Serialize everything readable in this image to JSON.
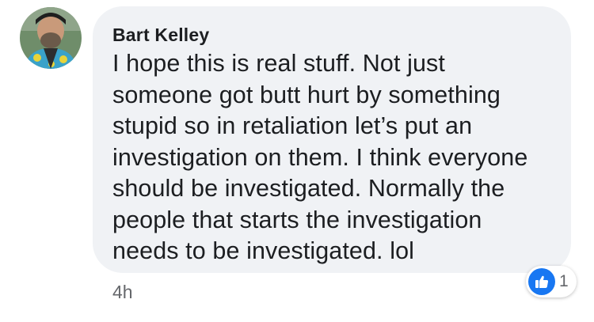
{
  "comment": {
    "author": "Bart Kelley",
    "text_lines": [
      "I hope this is real stuff. Not just",
      "someone got butt hurt by something",
      "stupid so in retaliation let’s put an",
      "investigation on them. I think everyone",
      "should be investigated. Normally the",
      "people that starts the investigation",
      "needs to be investigated. lol"
    ],
    "timestamp": "4h",
    "reactions": {
      "icon": "like-icon",
      "count": "1"
    }
  },
  "colors": {
    "bubble": "#f0f2f5",
    "text": "#1c1e21",
    "meta": "#65676b",
    "like": "#1877f2"
  }
}
